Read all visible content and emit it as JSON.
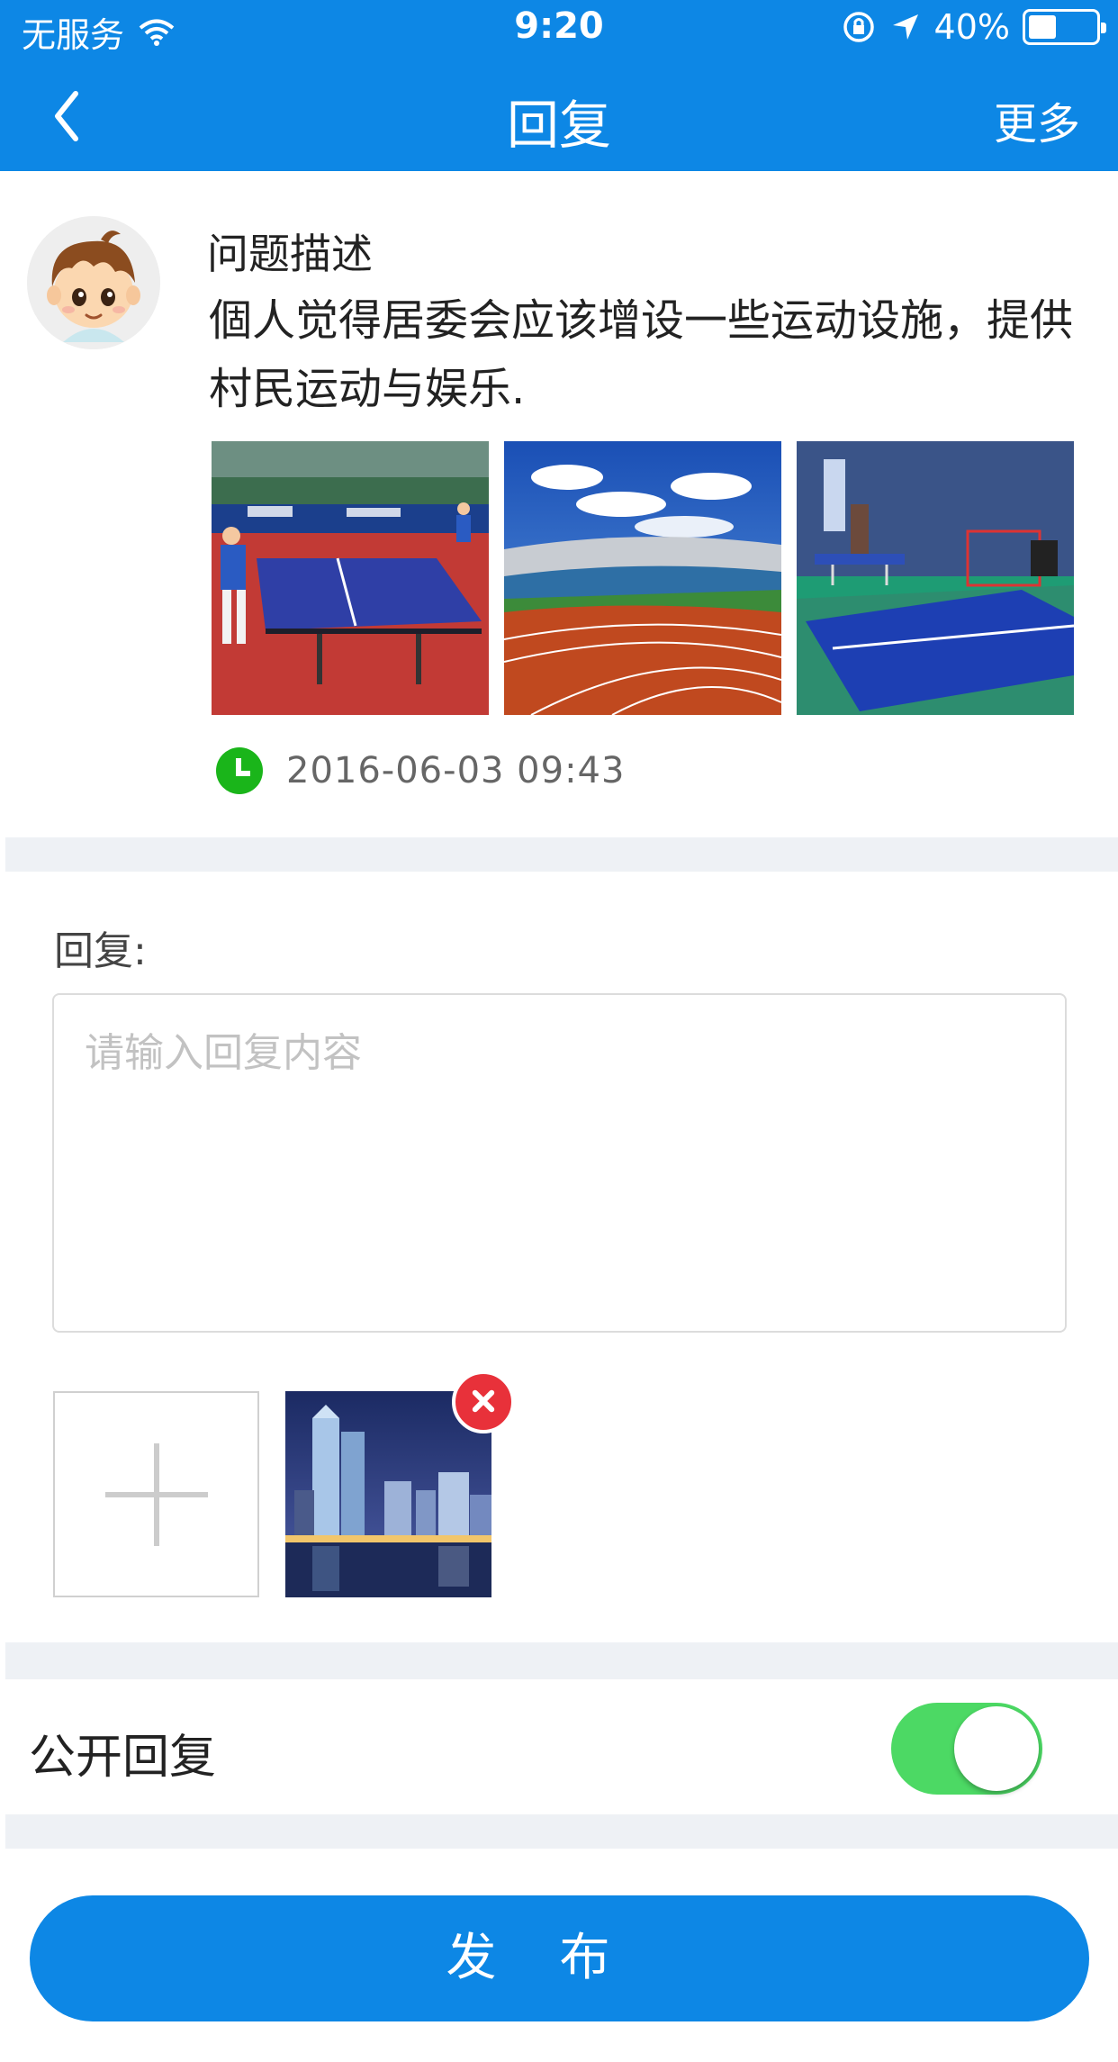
{
  "status_bar": {
    "carrier": "无服务",
    "time": "9:20",
    "battery_text": "40%",
    "battery_level": 0.4
  },
  "nav": {
    "title": "回复",
    "more_label": "更多"
  },
  "question": {
    "heading": "问题描述",
    "text": "個人觉得居委会应该增设一些运动设施，提供村民运动与娱乐.",
    "photos": [
      "ping-pong-hall-photo",
      "stadium-track-photo",
      "indoor-table-tennis-photo"
    ],
    "timestamp": "2016-06-03  09:43"
  },
  "reply": {
    "label": "回复:",
    "placeholder": "请输入回复内容",
    "value": ""
  },
  "attachments": {
    "add_icon": "plus-icon",
    "items": [
      "city-night-photo"
    ]
  },
  "public_reply": {
    "label": "公开回复",
    "enabled": true
  },
  "publish_label": "发布",
  "colors": {
    "primary": "#0d87e5",
    "toggle_on": "#4cd964",
    "remove": "#e8313a",
    "clock": "#1ab51a",
    "divider": "#eef1f5"
  }
}
